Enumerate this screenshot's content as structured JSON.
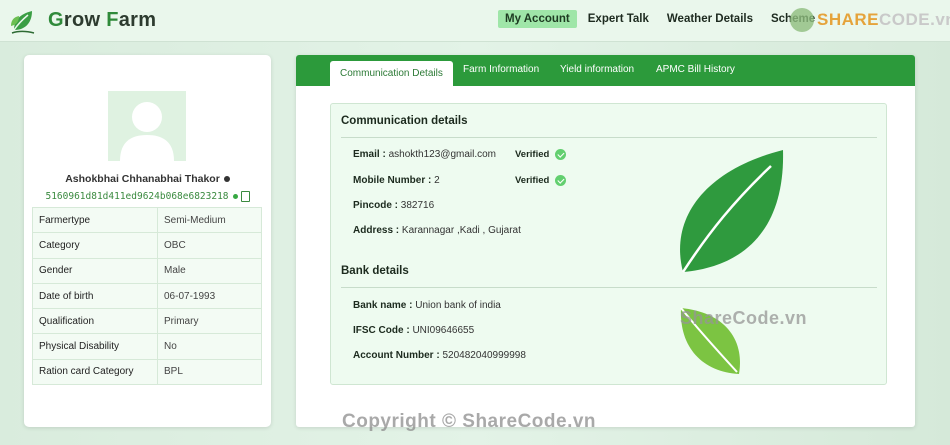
{
  "brand": {
    "name_initial": "G",
    "name_rest": "row ",
    "name_initial2": "F",
    "name_rest2": "arm"
  },
  "nav": {
    "items": [
      {
        "label": "My Account",
        "active": true
      },
      {
        "label": "Expert Talk",
        "active": false
      },
      {
        "label": "Weather Details",
        "active": false
      },
      {
        "label": "Scheme",
        "active": false
      }
    ]
  },
  "watermarks": {
    "top_left": "SHARE",
    "top_right": "CODE.vn",
    "middle": "ShareCode.vn",
    "bottom": "Copyright © ShareCode.vn"
  },
  "profile": {
    "name": "Ashokbhai Chhanabhai Thakor",
    "hash": "5160961d81d411ed9624b068e6823218",
    "fields": [
      {
        "key": "Farmertype",
        "value": "Semi-Medium"
      },
      {
        "key": "Category",
        "value": "OBC"
      },
      {
        "key": "Gender",
        "value": "Male"
      },
      {
        "key": "Date of birth",
        "value": "06-07-1993"
      },
      {
        "key": "Qualification",
        "value": "Primary"
      },
      {
        "key": "Physical Disability",
        "value": "No"
      },
      {
        "key": "Ration card Category",
        "value": "BPL"
      }
    ]
  },
  "tabs": [
    {
      "label": "Communication Details",
      "active": true
    },
    {
      "label": "Farm Information",
      "active": false
    },
    {
      "label": "Yield information",
      "active": false
    },
    {
      "label": "APMC Bill History",
      "active": false
    }
  ],
  "communication": {
    "title": "Communication details",
    "email_label": "Email :",
    "email": "ashokth123@gmail.com",
    "mobile_label": "Mobile Number :",
    "mobile": "2",
    "verified_label": "Verified",
    "pincode_label": "Pincode :",
    "pincode": "382716",
    "address_label": "Address :",
    "address": "Karannagar ,Kadi , Gujarat"
  },
  "bank": {
    "title": "Bank details",
    "name_label": "Bank name :",
    "name": "Union bank of india",
    "ifsc_label": "IFSC Code :",
    "ifsc": "UNI09646655",
    "account_label": "Account Number :",
    "account": "520482040999998"
  },
  "colors": {
    "accent": "#2c9a3b",
    "active_nav": "#9fe6a8",
    "leaf_dark": "#2f9a3e",
    "leaf_light": "#7cc442"
  }
}
